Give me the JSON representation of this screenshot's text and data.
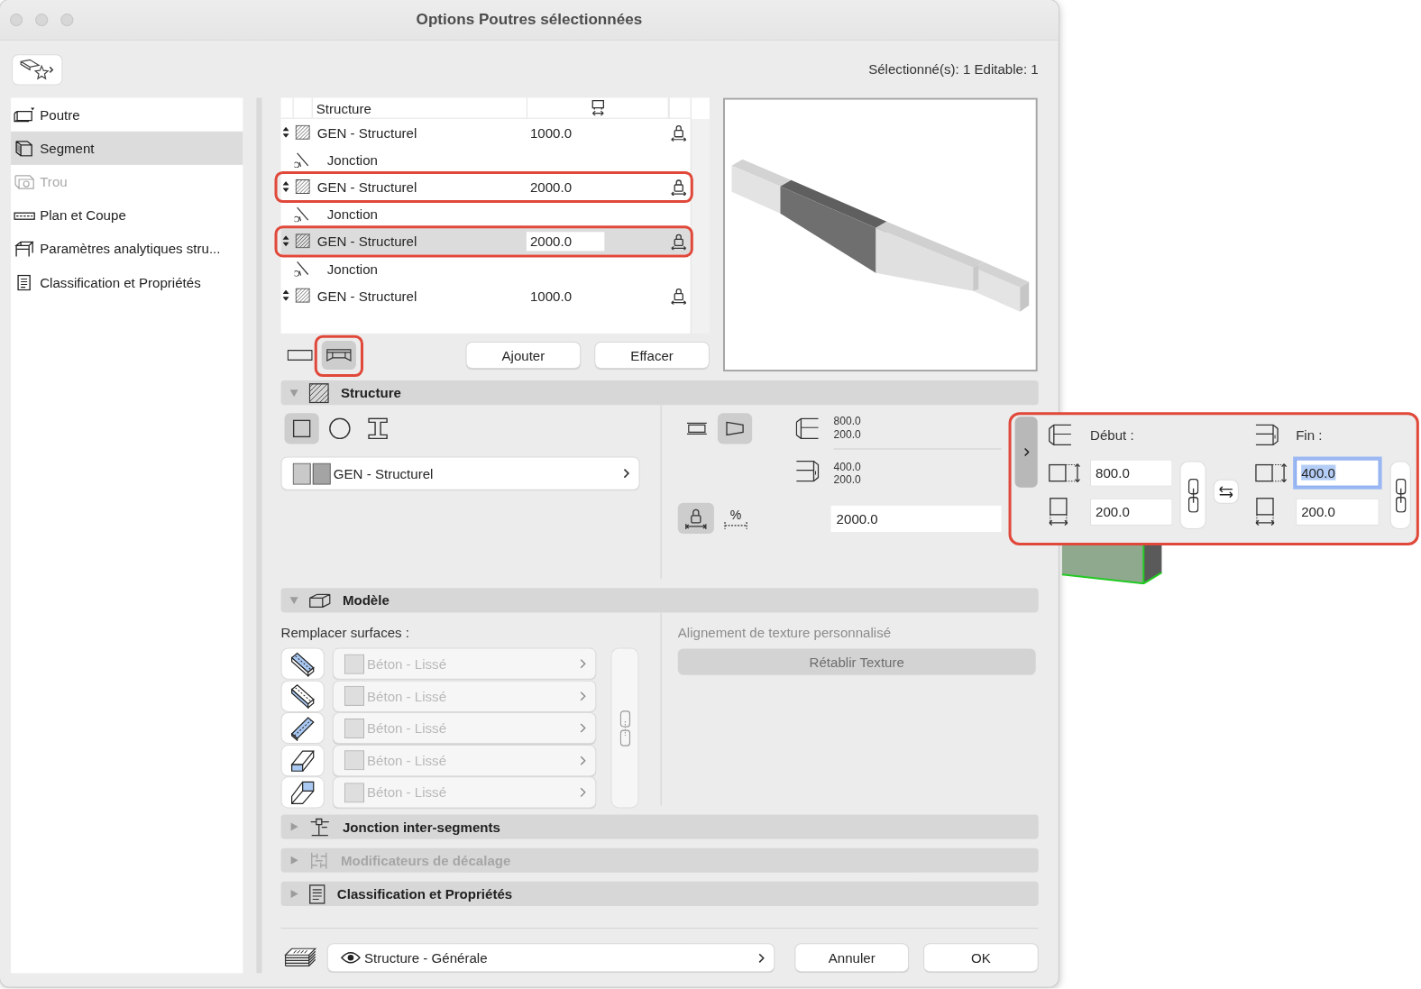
{
  "window": {
    "title": "Options Poutres sélectionnées"
  },
  "toolbar": {
    "selection_info": "Sélectionné(s): 1 Editable: 1"
  },
  "sidebar": {
    "items": [
      {
        "label": "Poutre",
        "selected": false,
        "disabled": false
      },
      {
        "label": "Segment",
        "selected": true,
        "disabled": false
      },
      {
        "label": "Trou",
        "selected": false,
        "disabled": true
      },
      {
        "label": "Plan et Coupe",
        "selected": false,
        "disabled": false
      },
      {
        "label": "Paramètres analytiques stru...",
        "selected": false,
        "disabled": false
      },
      {
        "label": "Classification et Propriétés",
        "selected": false,
        "disabled": false
      }
    ]
  },
  "segment_table": {
    "columns": [
      "Structure"
    ],
    "rows": [
      {
        "kind": "segment",
        "label": "GEN - Structurel",
        "value": "1000.0",
        "selected": false,
        "highlighted": false
      },
      {
        "kind": "junction",
        "label": "Jonction"
      },
      {
        "kind": "segment",
        "label": "GEN - Structurel",
        "value": "2000.0",
        "selected": false,
        "highlighted": true
      },
      {
        "kind": "junction",
        "label": "Jonction"
      },
      {
        "kind": "segment",
        "label": "GEN - Structurel",
        "value": "2000.0",
        "selected": true,
        "highlighted": true
      },
      {
        "kind": "junction",
        "label": "Jonction"
      },
      {
        "kind": "segment",
        "label": "GEN - Structurel",
        "value": "1000.0",
        "selected": false,
        "highlighted": false
      }
    ]
  },
  "segment_tools": {
    "mode_buttons": [
      {
        "selected": false,
        "highlighted": false
      },
      {
        "selected": true,
        "highlighted": true
      }
    ],
    "buttons": [
      "Ajouter",
      "Effacer"
    ]
  },
  "sections": [
    {
      "kind": "structure",
      "title": "Structure",
      "expanded": true,
      "disabled": false
    },
    {
      "kind": "model",
      "title": "Modèle",
      "expanded": true,
      "disabled": false
    },
    {
      "kind": "junction",
      "title": "Jonction inter-segments",
      "expanded": false,
      "disabled": false
    },
    {
      "kind": "offset",
      "title": "Modificateurs de décalage",
      "expanded": false,
      "disabled": true
    },
    {
      "kind": "classification",
      "title": "Classification et Propriétés",
      "expanded": false,
      "disabled": false
    }
  ],
  "structure": {
    "shape_buttons": [
      {
        "selected": true
      },
      {
        "selected": false
      },
      {
        "selected": false
      }
    ],
    "profile": "GEN - Structurel",
    "taper_buttons": [
      {
        "selected": false
      },
      {
        "selected": true
      }
    ],
    "start_dimensions": [
      "800.0",
      "200.0"
    ],
    "end_dimensions": [
      "400.0",
      "200.0"
    ],
    "length_modes": [
      {
        "kind": "lock",
        "selected": true
      },
      {
        "kind": "percent",
        "symbol": "%",
        "selected": false
      }
    ],
    "length": "2000.0"
  },
  "profile_popup": {
    "highlighted": true,
    "ends": [
      {
        "label": "Début :",
        "height": {
          "value": "800.0",
          "focused": false
        },
        "width": {
          "value": "200.0",
          "focused": false
        }
      },
      {
        "label": "Fin :",
        "height": {
          "value": "400.0",
          "focused": true
        },
        "width": {
          "value": "200.0",
          "focused": false
        }
      }
    ]
  },
  "model": {
    "surfaces_label": "Remplacer surfaces :",
    "surfaces": [
      {
        "material": "Béton - Lissé",
        "disabled": true
      },
      {
        "material": "Béton - Lissé",
        "disabled": true
      },
      {
        "material": "Béton - Lissé",
        "disabled": true
      },
      {
        "material": "Béton - Lissé",
        "disabled": true
      },
      {
        "material": "Béton - Lissé",
        "disabled": true
      }
    ],
    "texture_label": "Alignement de texture personnalisé",
    "reset_button": {
      "label": "Rétablir Texture",
      "disabled": true
    }
  },
  "footer": {
    "layer": "Structure - Générale",
    "buttons": [
      "Annuler",
      "OK"
    ]
  }
}
